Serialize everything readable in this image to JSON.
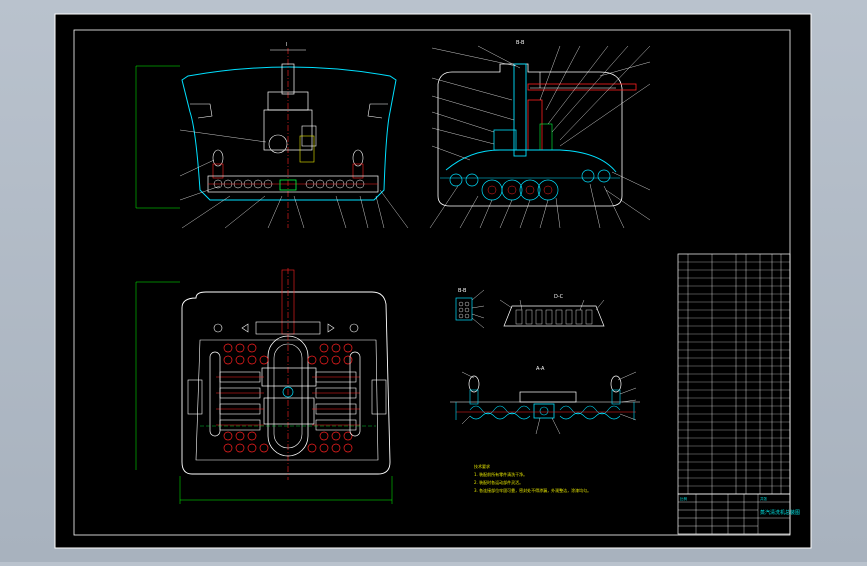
{
  "drawing": {
    "background": "#000000",
    "frame_color": "#ffffff",
    "outline_color": "#00e0ff",
    "accent_red": "#ff2020",
    "accent_green": "#00ff40",
    "dim_color": "#00ff00"
  },
  "views": {
    "front_label": "I",
    "side_label": "B-B",
    "small_left_label": "B-B",
    "small_right_label": "D-C",
    "bottom_section_label": "A-A"
  },
  "notes": {
    "heading": "技术要求",
    "line1": "1. 装配前所有零件清洗干净。",
    "line2": "2. 装配时各运动部件灵活。",
    "line3": "3. 各连接部位牢固可靠，密封处不得渗漏，外观整洁，涂漆均匀。"
  },
  "title_block": {
    "drawing_name": "蒸汽清洗机总装图",
    "scale_header": "比例",
    "sheet_header": "共张"
  }
}
